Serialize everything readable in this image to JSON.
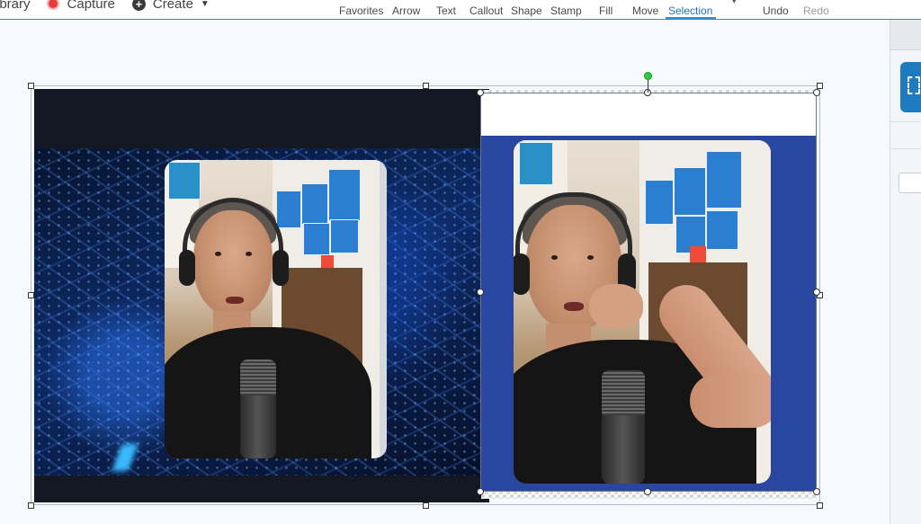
{
  "toolbar_left": {
    "library_label": "ibrary",
    "capture_label": "Capture",
    "create_label": "Create"
  },
  "tools": [
    {
      "label": "Favorites"
    },
    {
      "label": "Arrow"
    },
    {
      "label": "Text"
    },
    {
      "label": "Callout"
    },
    {
      "label": "Shape"
    },
    {
      "label": "Stamp"
    },
    {
      "label": "Fill"
    },
    {
      "label": "Move"
    },
    {
      "label": "Selection"
    },
    {
      "label": "Undo"
    },
    {
      "label": "Redo"
    }
  ],
  "active_tool": "Selection",
  "colors": {
    "accent": "#2a8fd6",
    "active_text": "#1a73c9",
    "capture_red": "#e53b3b",
    "right_bg": "#2946a1",
    "left_bg": "#131823",
    "rotate_handle": "#2ecc40"
  },
  "icons": [
    "capture-record-icon",
    "create-plus-icon",
    "create-dropdown-caret-icon",
    "selection-marquee-icon"
  ]
}
